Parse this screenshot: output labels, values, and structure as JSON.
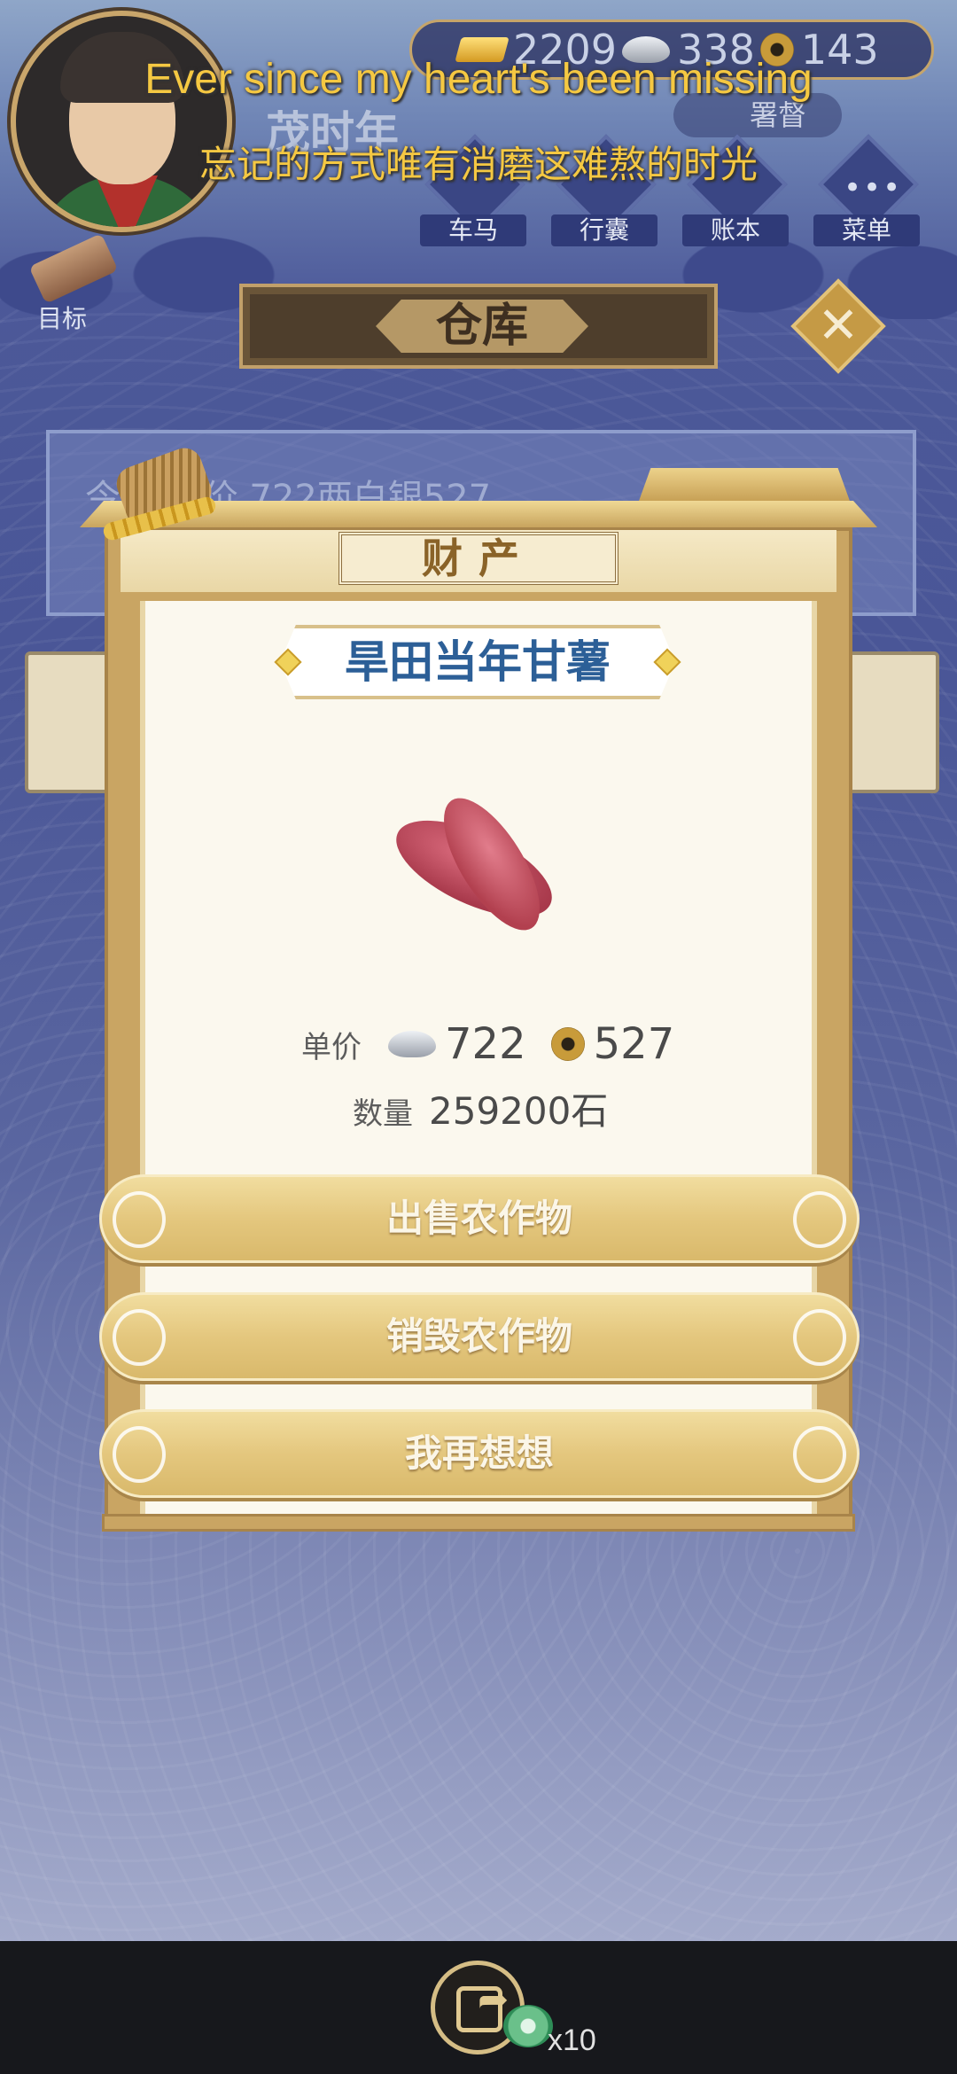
{
  "hud": {
    "season_title": "茂时年",
    "currency": {
      "gold": "2209",
      "silver": "338",
      "copper": "143"
    },
    "official_label": "署督",
    "menu": [
      {
        "label": "车马",
        "icon": "carriage-icon"
      },
      {
        "label": "行囊",
        "icon": "bag-icon"
      },
      {
        "label": "账本",
        "icon": "ledger-icon"
      },
      {
        "label": "菜单",
        "icon": "menu-dots-icon"
      }
    ],
    "goal_label": "目标"
  },
  "warehouse": {
    "title": "仓库",
    "notice_text": "今 薯售价 722两白银527"
  },
  "lyrics": {
    "english": "Ever since my heart's been missing",
    "chinese": "忘记的方式唯有消磨这难熬的时光"
  },
  "dialog": {
    "header": "财产",
    "crop_name": "旱田当年甘薯",
    "price_label": "单价",
    "price_silver": "722",
    "price_copper": "527",
    "quantity_label": "数量",
    "quantity_value": "259200石",
    "buttons": {
      "sell": "出售农作物",
      "destroy": "销毁农作物",
      "reconsider": "我再想想"
    }
  },
  "share": {
    "count": "x10"
  },
  "colors": {
    "accent_gold": "#d9b96b",
    "crop_title_blue": "#2c5f97",
    "lyric_yellow": "#f5c842",
    "background_blue": "#4a5697"
  }
}
